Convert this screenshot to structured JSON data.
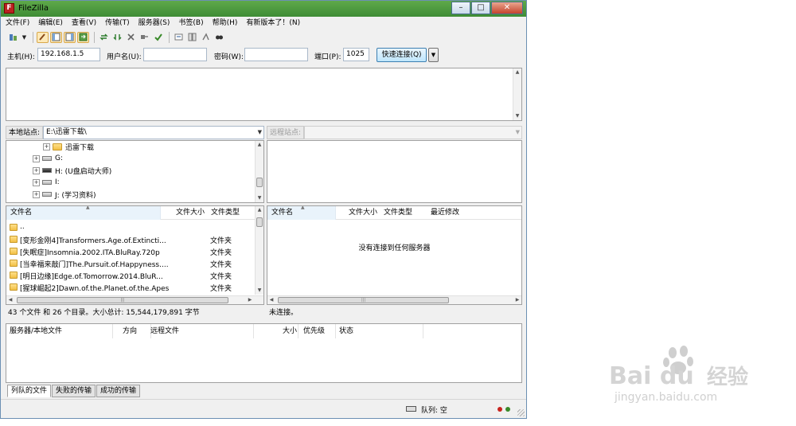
{
  "window": {
    "title": "FileZilla",
    "icon_letter": "F",
    "minimize": "–",
    "maximize": "□",
    "close": "✕"
  },
  "menu": [
    "文件(F)",
    "编辑(E)",
    "查看(V)",
    "传输(T)",
    "服务器(S)",
    "书签(B)",
    "帮助(H)",
    "有新版本了！(N)"
  ],
  "quickconnect": {
    "host_label": "主机(H):",
    "host_value": "192.168.1.5",
    "user_label": "用户名(U):",
    "user_value": "",
    "pass_label": "密码(W):",
    "pass_value": "",
    "port_label": "端口(P):",
    "port_value": "1025",
    "connect_label": "快速连接(Q)"
  },
  "local": {
    "site_label": "本地站点:",
    "path": "E:\\迅雷下载\\",
    "tree": [
      {
        "label": "迅雷下载",
        "kind": "folder"
      },
      {
        "label": "G:",
        "kind": "drive"
      },
      {
        "label": "H: (U盘启动大师)",
        "kind": "drive-dark"
      },
      {
        "label": "I:",
        "kind": "drive"
      },
      {
        "label": "J: (学习资料)",
        "kind": "drive"
      }
    ],
    "columns": {
      "name": "文件名",
      "size": "文件大小",
      "type": "文件类型"
    },
    "files": [
      {
        "name": "..",
        "type": ""
      },
      {
        "name": "[变形金刚4]Transformers.Age.of.Extincti...",
        "type": "文件夹"
      },
      {
        "name": "[失眠症]Insomnia.2002.ITA.BluRay.720p",
        "type": "文件夹"
      },
      {
        "name": "[当幸福来敲门]The.Pursuit.of.Happyness....",
        "type": "文件夹"
      },
      {
        "name": "[明日边缘]Edge.of.Tomorrow.2014.BluR...",
        "type": "文件夹"
      },
      {
        "name": "[猩球崛起2]Dawn.of.the.Planet.of.the.Apes",
        "type": "文件夹"
      }
    ],
    "status": "43 个文件 和 26 个目录。大小总计: 15,544,179,891 字节"
  },
  "remote": {
    "site_label": "远程站点:",
    "path": "",
    "columns": {
      "name": "文件名",
      "size": "文件大小",
      "type": "文件类型",
      "modified": "最近修改"
    },
    "empty_message": "没有连接到任何服务器",
    "status": "未连接。"
  },
  "queue": {
    "columns": {
      "server_local": "服务器/本地文件",
      "direction": "方向",
      "remote": "远程文件",
      "size": "大小",
      "priority": "优先级",
      "status": "状态"
    },
    "tabs": [
      "列队的文件",
      "失败的传输",
      "成功的传输"
    ],
    "queue_status": "队列: 空"
  },
  "colors": {
    "titlebar": "#4a9a3e",
    "led_red": "#c8241e",
    "led_green": "#3a8a2a"
  },
  "watermark": {
    "text": "Baidu经验",
    "url": "jingyan.baidu.com"
  }
}
